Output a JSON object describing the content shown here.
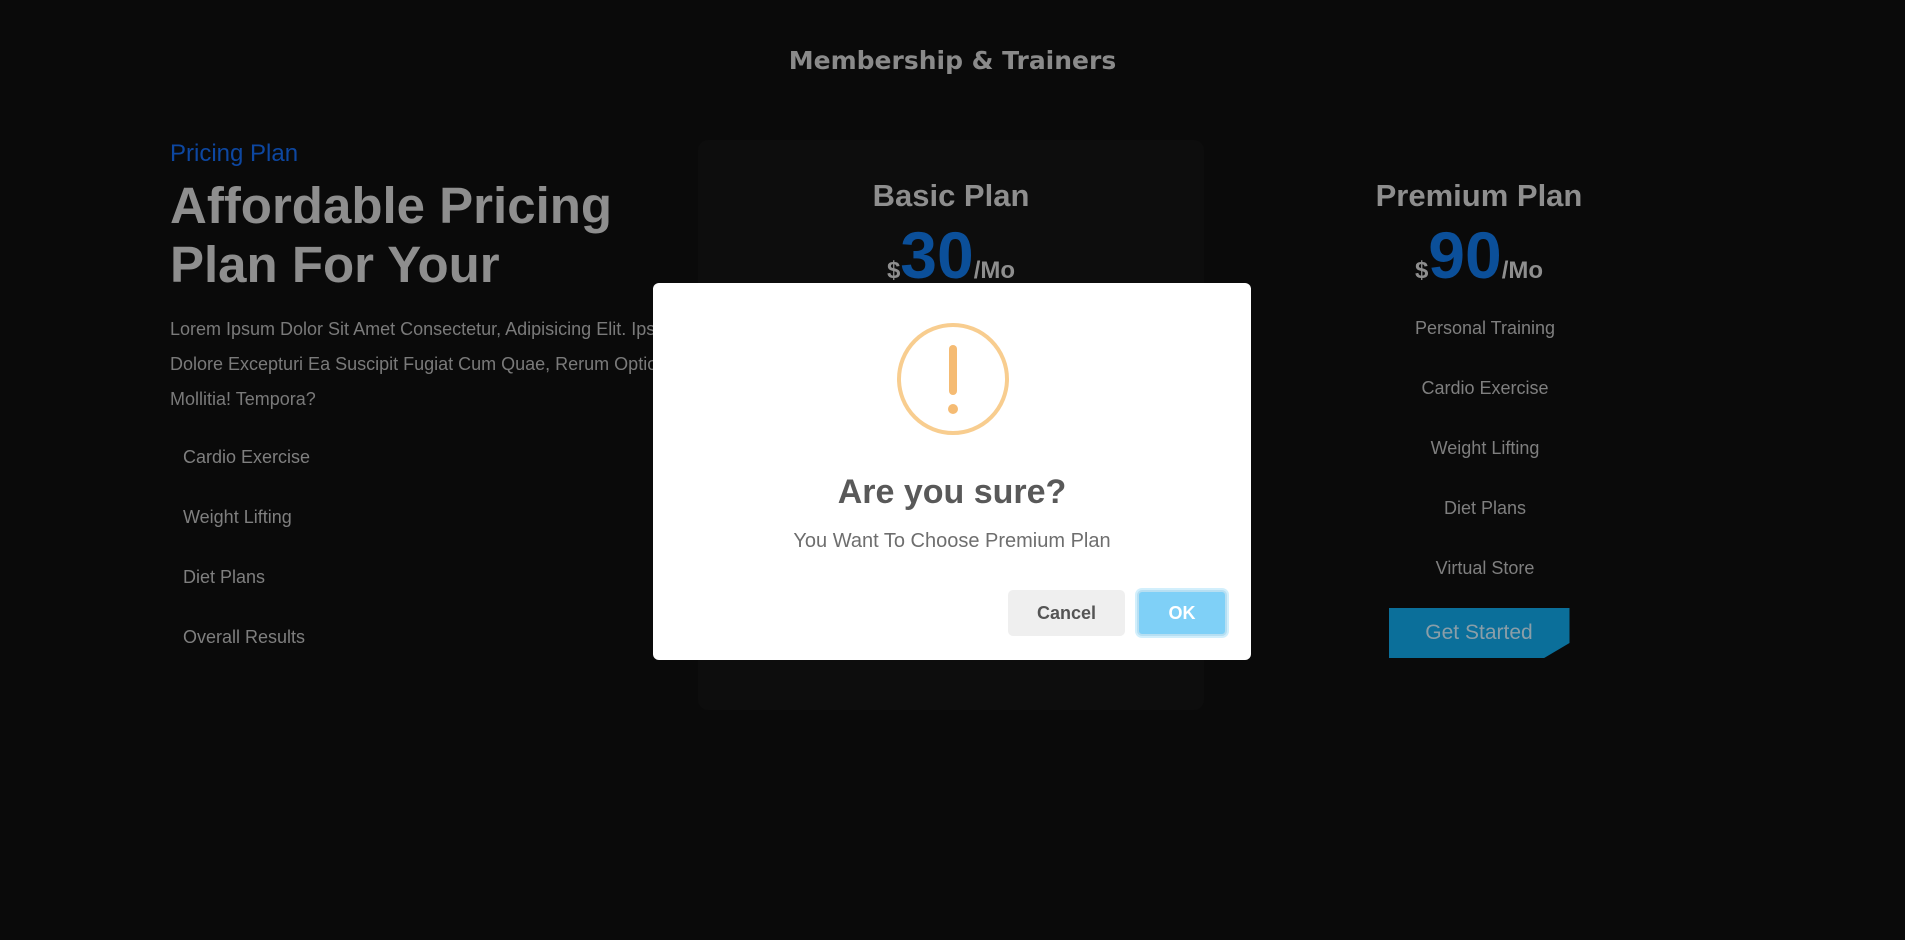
{
  "section": {
    "title": "Membership & Trainers"
  },
  "intro": {
    "eyebrow": "Pricing Plan",
    "headline": "Affordable Pricing Plan For Your",
    "lead": "Lorem Ipsum Dolor Sit Amet Consectetur, Adipisicing Elit. Ipsa\nDolore Excepturi Ea Suscipit Fugiat Cum Quae, Rerum Optio\nMollitia! Tempora?",
    "features": [
      "Cardio Exercise",
      "Weight Lifting",
      "Diet Plans",
      "Overall Results"
    ]
  },
  "plans": [
    {
      "name": "Basic Plan",
      "currency": "$",
      "amount": "30",
      "period": "/Mo"
    },
    {
      "name": "Premium Plan",
      "currency": "$",
      "amount": "90",
      "period": "/Mo",
      "features": [
        "Personal Training",
        "Cardio Exercise",
        "Weight Lifting",
        "Diet Plans",
        "Virtual Store"
      ],
      "cta": "Get Started"
    }
  ],
  "dialog": {
    "icon": "warning-icon",
    "title": "Are you sure?",
    "text": "You Want To Choose Premium Plan",
    "cancel_label": "Cancel",
    "ok_label": "OK"
  },
  "colors": {
    "accent_blue": "#0b4f99",
    "cta_bg": "#0b6f9a",
    "ok_button": "#7fd0f7",
    "warning": "#f8cd8f"
  }
}
